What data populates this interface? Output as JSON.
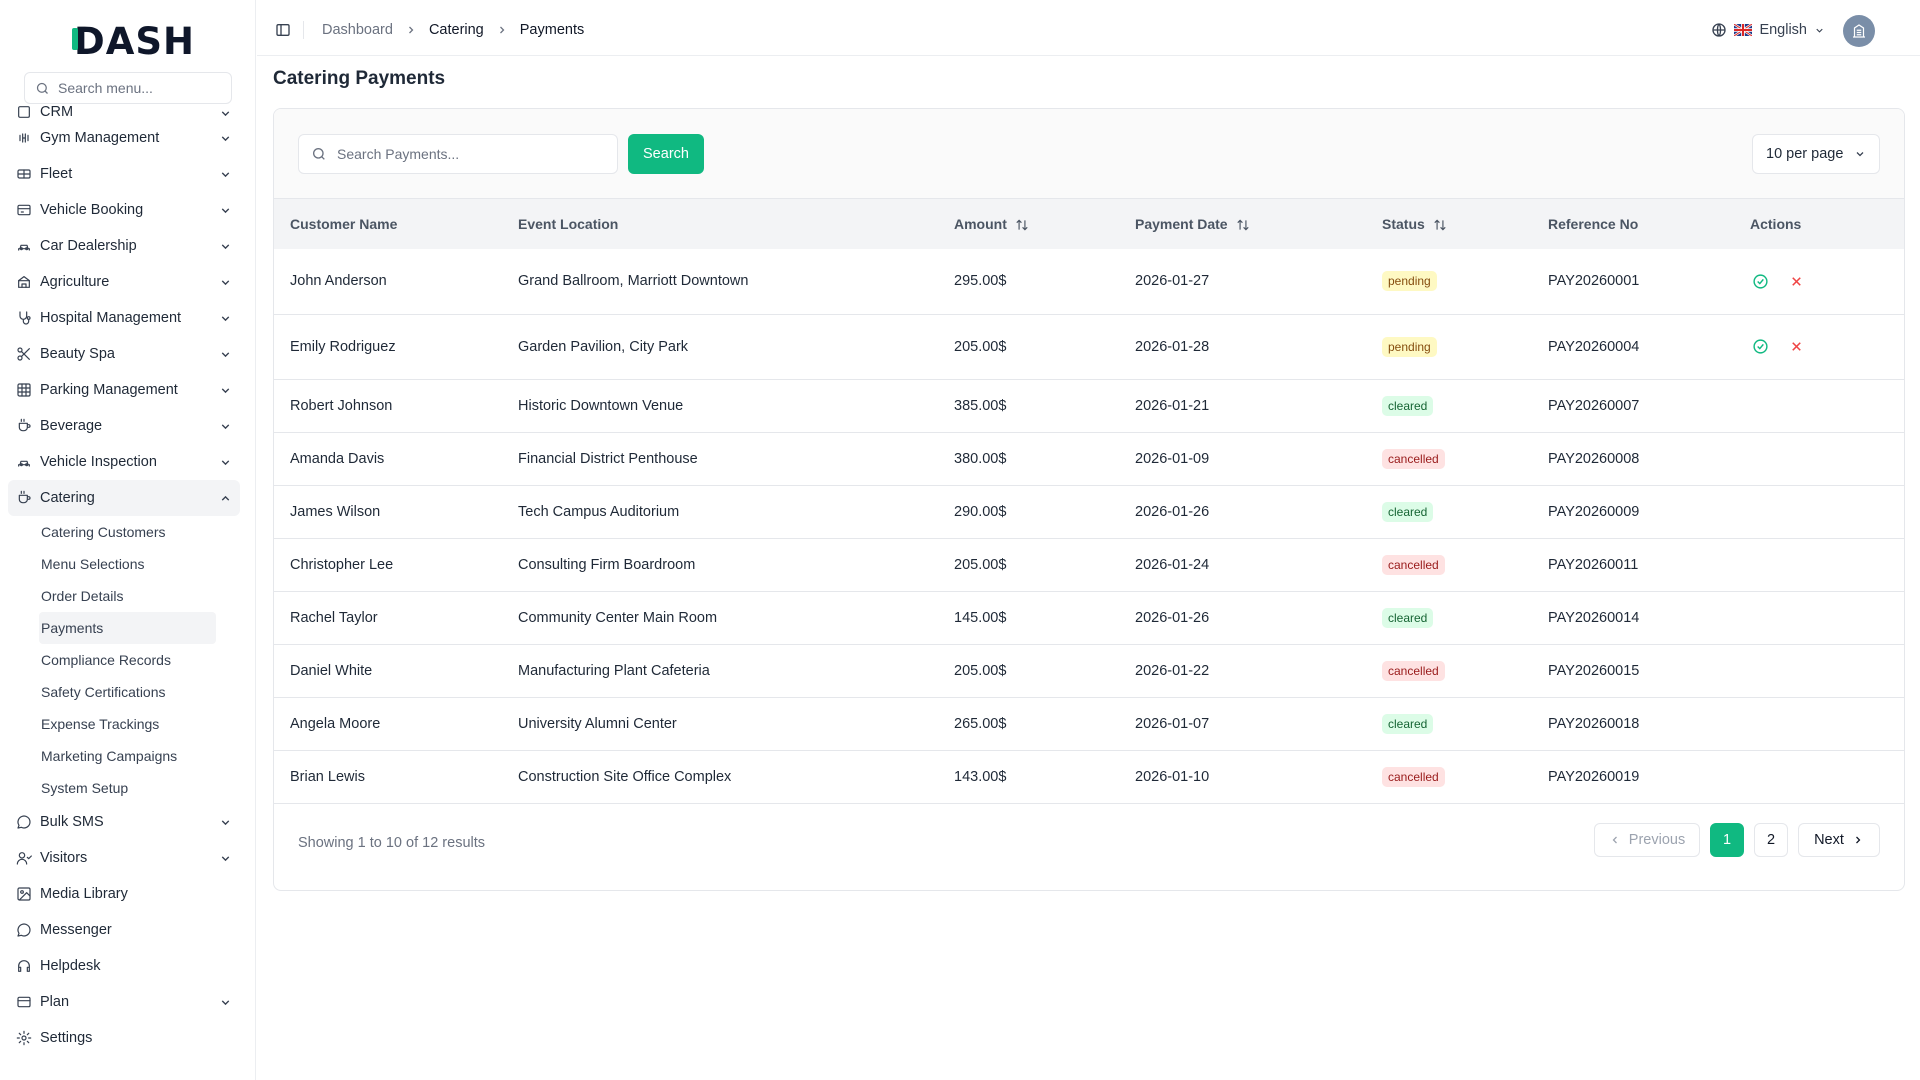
{
  "app": {
    "logo": "DASH"
  },
  "sidebar": {
    "search_placeholder": "Search menu...",
    "cut_item": "CRM",
    "items": [
      {
        "label": "Gym Management",
        "icon": "gym-icon"
      },
      {
        "label": "Fleet",
        "icon": "fleet-icon"
      },
      {
        "label": "Vehicle Booking",
        "icon": "vehicle-booking-icon"
      },
      {
        "label": "Car Dealership",
        "icon": "car-icon"
      },
      {
        "label": "Agriculture",
        "icon": "agriculture-icon"
      },
      {
        "label": "Hospital Management",
        "icon": "stethoscope-icon"
      },
      {
        "label": "Beauty Spa",
        "icon": "scissors-icon"
      },
      {
        "label": "Parking Management",
        "icon": "grid-icon"
      },
      {
        "label": "Beverage",
        "icon": "cup-icon"
      },
      {
        "label": "Vehicle Inspection",
        "icon": "car-icon"
      }
    ],
    "active_group": {
      "label": "Catering",
      "icon": "cup-icon"
    },
    "sub_items": [
      "Catering Customers",
      "Menu Selections",
      "Order Details",
      "Payments",
      "Compliance Records",
      "Safety Certifications",
      "Expense Trackings",
      "Marketing Campaigns",
      "System Setup"
    ],
    "items_after": [
      {
        "label": "Bulk SMS",
        "icon": "sms-icon",
        "chevron": true
      },
      {
        "label": "Visitors",
        "icon": "user-icon",
        "chevron": true
      },
      {
        "label": "Media Library",
        "icon": "image-icon",
        "chevron": false
      },
      {
        "label": "Messenger",
        "icon": "chat-icon",
        "chevron": false
      },
      {
        "label": "Helpdesk",
        "icon": "headset-icon",
        "chevron": false
      },
      {
        "label": "Plan",
        "icon": "card-icon",
        "chevron": true
      },
      {
        "label": "Settings",
        "icon": "gear-icon",
        "chevron": false
      }
    ]
  },
  "topbar": {
    "breadcrumb": [
      "Dashboard",
      "Catering",
      "Payments"
    ],
    "language": "English"
  },
  "page": {
    "title": "Catering Payments"
  },
  "toolbar": {
    "search_placeholder": "Search Payments...",
    "search_label": "Search",
    "per_page": "10 per page"
  },
  "table": {
    "columns": [
      "Customer Name",
      "Event Location",
      "Amount",
      "Payment Date",
      "Status",
      "Reference No",
      "Actions"
    ],
    "rows": [
      {
        "name": "John Anderson",
        "location": "Grand Ballroom, Marriott Downtown",
        "amount": "295.00$",
        "date": "2026-01-27",
        "status": "pending",
        "ref": "PAY20260001"
      },
      {
        "name": "Emily Rodriguez",
        "location": "Garden Pavilion, City Park",
        "amount": "205.00$",
        "date": "2026-01-28",
        "status": "pending",
        "ref": "PAY20260004"
      },
      {
        "name": "Robert Johnson",
        "location": "Historic Downtown Venue",
        "amount": "385.00$",
        "date": "2026-01-21",
        "status": "cleared",
        "ref": "PAY20260007"
      },
      {
        "name": "Amanda Davis",
        "location": "Financial District Penthouse",
        "amount": "380.00$",
        "date": "2026-01-09",
        "status": "cancelled",
        "ref": "PAY20260008"
      },
      {
        "name": "James Wilson",
        "location": "Tech Campus Auditorium",
        "amount": "290.00$",
        "date": "2026-01-26",
        "status": "cleared",
        "ref": "PAY20260009"
      },
      {
        "name": "Christopher Lee",
        "location": "Consulting Firm Boardroom",
        "amount": "205.00$",
        "date": "2026-01-24",
        "status": "cancelled",
        "ref": "PAY20260011"
      },
      {
        "name": "Rachel Taylor",
        "location": "Community Center Main Room",
        "amount": "145.00$",
        "date": "2026-01-26",
        "status": "cleared",
        "ref": "PAY20260014"
      },
      {
        "name": "Daniel White",
        "location": "Manufacturing Plant Cafeteria",
        "amount": "205.00$",
        "date": "2026-01-22",
        "status": "cancelled",
        "ref": "PAY20260015"
      },
      {
        "name": "Angela Moore",
        "location": "University Alumni Center",
        "amount": "265.00$",
        "date": "2026-01-07",
        "status": "cleared",
        "ref": "PAY20260018"
      },
      {
        "name": "Brian Lewis",
        "location": "Construction Site Office Complex",
        "amount": "143.00$",
        "date": "2026-01-10",
        "status": "cancelled",
        "ref": "PAY20260019"
      }
    ]
  },
  "pagination": {
    "summary": "Showing 1 to 10 of 12 results",
    "previous": "Previous",
    "next": "Next",
    "pages": [
      "1",
      "2"
    ],
    "current": "1"
  },
  "colors": {
    "accent": "#10b981",
    "pending": "#fef9c3",
    "cleared": "#dcfce7",
    "cancelled": "#fee2e2"
  }
}
